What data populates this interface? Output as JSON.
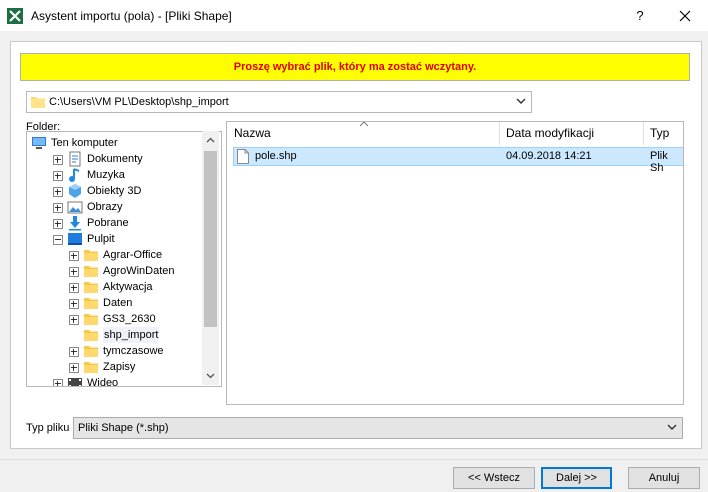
{
  "window": {
    "title": "Asystent importu (pola) - [Pliki Shape]",
    "help_label": "?"
  },
  "banner": {
    "message": "Proszę wybrać plik, który ma zostać wczytany.",
    "bg_color": "#ffff00",
    "text_color": "#e00000"
  },
  "path": {
    "value": "C:\\Users\\VM PL\\Desktop\\shp_import"
  },
  "tree": {
    "label": "Folder:",
    "items": [
      {
        "label": "Ten komputer",
        "icon": "computer-icon",
        "level": 0,
        "expander": "none"
      },
      {
        "label": "Dokumenty",
        "icon": "documents-icon",
        "level": 1,
        "expander": "plus"
      },
      {
        "label": "Muzyka",
        "icon": "music-icon",
        "level": 1,
        "expander": "plus"
      },
      {
        "label": "Obiekty 3D",
        "icon": "objects3d-icon",
        "level": 1,
        "expander": "plus"
      },
      {
        "label": "Obrazy",
        "icon": "pictures-icon",
        "level": 1,
        "expander": "plus"
      },
      {
        "label": "Pobrane",
        "icon": "downloads-icon",
        "level": 1,
        "expander": "plus"
      },
      {
        "label": "Pulpit",
        "icon": "desktop-icon",
        "level": 1,
        "expander": "minus"
      },
      {
        "label": "Agrar-Office",
        "icon": "folder-icon",
        "level": 2,
        "expander": "plus"
      },
      {
        "label": "AgroWinDaten",
        "icon": "folder-icon",
        "level": 2,
        "expander": "plus"
      },
      {
        "label": "Aktywacja",
        "icon": "folder-icon",
        "level": 2,
        "expander": "plus"
      },
      {
        "label": "Daten",
        "icon": "folder-icon",
        "level": 2,
        "expander": "plus"
      },
      {
        "label": "GS3_2630",
        "icon": "folder-icon",
        "level": 2,
        "expander": "plus"
      },
      {
        "label": "shp_import",
        "icon": "folder-icon",
        "level": 2,
        "expander": "none",
        "selected": true
      },
      {
        "label": "tymczasowe",
        "icon": "folder-icon",
        "level": 2,
        "expander": "plus"
      },
      {
        "label": "Zapisy",
        "icon": "folder-icon",
        "level": 2,
        "expander": "plus"
      },
      {
        "label": "Wideo",
        "icon": "video-icon",
        "level": 1,
        "expander": "plus"
      }
    ]
  },
  "files": {
    "columns": [
      "Nazwa",
      "Data modyfikacji",
      "Typ"
    ],
    "rows": [
      {
        "name": "pole.shp",
        "modified": "04.09.2018 14:21",
        "type": "Plik Sh"
      }
    ]
  },
  "filetype": {
    "label": "Typ pliku",
    "value": "Pliki Shape (*.shp)"
  },
  "buttons": {
    "back": "<< Wstecz",
    "next": "Dalej >>",
    "cancel": "Anuluj"
  }
}
